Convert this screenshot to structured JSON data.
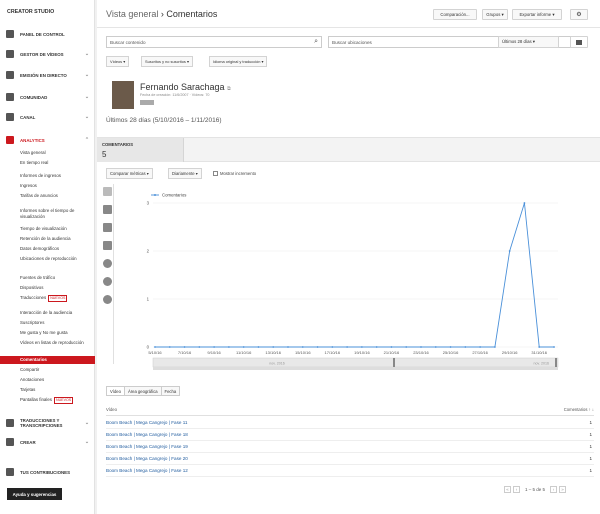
{
  "sidebar": {
    "title": "CREATOR STUDIO",
    "sections": [
      {
        "label": "PANEL DE CONTROL",
        "icon": "dashboard-icon",
        "chev": ""
      },
      {
        "label": "GESTOR DE VÍDEOS",
        "icon": "video-manager-icon",
        "chev": "⌄"
      },
      {
        "label": "EMISIÓN EN DIRECTO",
        "icon": "live-icon",
        "chev": "⌄"
      },
      {
        "label": "COMUNIDAD",
        "icon": "community-icon",
        "chev": "⌄"
      },
      {
        "label": "CANAL",
        "icon": "channel-icon",
        "chev": "⌄"
      },
      {
        "label": "ANALYTICS",
        "icon": "analytics-icon",
        "chev": "⌃"
      }
    ],
    "analytics_items": [
      {
        "label": "Vista general"
      },
      {
        "label": "En tiempo real"
      },
      {
        "label": "Informes de ingresos"
      },
      {
        "label": "Ingresos"
      },
      {
        "label": "Tarifas de anuncios"
      },
      {
        "label": "Informes sobre el tiempo de visualización"
      },
      {
        "label": "Tiempo de visualización"
      },
      {
        "label": "Retención de la audiencia"
      },
      {
        "label": "Datos demográficos"
      },
      {
        "label": "Ubicaciones de reproducción"
      },
      {
        "label": "Fuentes de tráfico"
      },
      {
        "label": "Dispositivos"
      },
      {
        "label": "Traducciones",
        "badge": "NUEVOS"
      },
      {
        "label": "Interacción de la audiencia"
      },
      {
        "label": "Suscriptores"
      },
      {
        "label": "Me gusta y No me gusta"
      },
      {
        "label": "Vídeos en listas de reproducción"
      },
      {
        "label": "Comentarios"
      },
      {
        "label": "Compartir"
      },
      {
        "label": "Anotaciones"
      },
      {
        "label": "Tarjetas"
      },
      {
        "label": "Pantallas finales",
        "badge": "NUEVOS"
      }
    ],
    "bottom_sections": [
      {
        "label": "TRADUCCIONES Y TRANSCRIPCIONES",
        "icon": "translate-icon",
        "chev": "⌄"
      },
      {
        "label": "CREAR",
        "icon": "create-icon",
        "chev": "⌄"
      },
      {
        "label": "TUS CONTRIBUCIONES",
        "icon": "contributions-icon",
        "chev": ""
      }
    ],
    "help_button": "Ayuda y sugerencias"
  },
  "header": {
    "crumb_first": "Vista general",
    "crumb_sep": "›",
    "crumb_current": "Comentarios",
    "compare_button": "Comparación...",
    "groups_button": "Grupos ▾",
    "export_button": "Exportar informe ▾",
    "settings_icon": "gear-icon"
  },
  "search": {
    "content_placeholder": "Buscar contenido",
    "location_placeholder": "Buscar ubicaciones",
    "period": "Últimos 28 días ▾",
    "calendar_icon": "calendar-icon"
  },
  "filters": [
    "Vídeos ▾",
    "Suscritos y no suscritos ▾",
    "Idioma original y traducción ▾"
  ],
  "profile": {
    "name": "Fernando Sarachaga",
    "link_icon": "external-link-icon",
    "meta": "Fecha de creación: 11/6/2007 · Vídeos: 70"
  },
  "period_text": "Últimos 28 días (5/10/2016 – 1/11/2016)",
  "metric": {
    "label": "COMENTARIOS",
    "value": "5"
  },
  "chart_controls": {
    "compare": "Comparar métricas ▾",
    "granularity": "Diariamente ▾",
    "show_increment": "Mostrar incremento"
  },
  "chart_data": {
    "type": "line",
    "legend": "Comentarios",
    "x": [
      "5/10/16",
      "6/10/16",
      "7/10/16",
      "8/10/16",
      "9/10/16",
      "10/10/16",
      "11/10/16",
      "12/10/16",
      "13/10/16",
      "14/10/16",
      "15/10/16",
      "16/10/16",
      "17/10/16",
      "18/10/16",
      "19/10/16",
      "20/10/16",
      "21/10/16",
      "22/10/16",
      "23/10/16",
      "24/10/16",
      "25/10/16",
      "26/10/16",
      "27/10/16",
      "28/10/16",
      "29/10/16",
      "30/10/16",
      "31/10/16",
      "1/11/16"
    ],
    "xticks": [
      "5/10/16",
      "7/10/16",
      "9/10/16",
      "11/10/16",
      "13/10/16",
      "15/10/16",
      "17/10/16",
      "19/10/16",
      "21/10/16",
      "23/10/16",
      "25/10/16",
      "27/10/16",
      "29/10/16",
      "31/10/16"
    ],
    "y": [
      0,
      0,
      0,
      0,
      0,
      0,
      0,
      0,
      0,
      0,
      0,
      0,
      0,
      0,
      0,
      0,
      0,
      0,
      0,
      0,
      0,
      0,
      0,
      0,
      2,
      3,
      0,
      0
    ],
    "ylim": [
      0,
      3
    ],
    "yticks": [
      0,
      1,
      2,
      3
    ],
    "navigator_labels": [
      "nov. 2016",
      "nov. 2016"
    ]
  },
  "table": {
    "tabs": [
      "Vídeo",
      "Área geográfica",
      "Fecha"
    ],
    "col_video": "Vídeo",
    "col_comments": "Comentarios ↑ ↓",
    "rows": [
      {
        "title": "Boom Beach | Mega Cangrejo | Fase 11",
        "value": "1"
      },
      {
        "title": "Boom Beach | Mega Cangrejo | Fase 18",
        "value": "1"
      },
      {
        "title": "Boom Beach | Mega Cangrejo | Fase 19",
        "value": "1"
      },
      {
        "title": "Boom Beach | Mega Cangrejo | Fase 20",
        "value": "1"
      },
      {
        "title": "Boom Beach | Mega Cangrejo | Fase 12",
        "value": "1"
      }
    ],
    "pager_text": "1 – 5 de 5"
  },
  "colors": {
    "accent": "#cc181e",
    "line": "#4a90d9",
    "link": "#1f5b9e"
  }
}
